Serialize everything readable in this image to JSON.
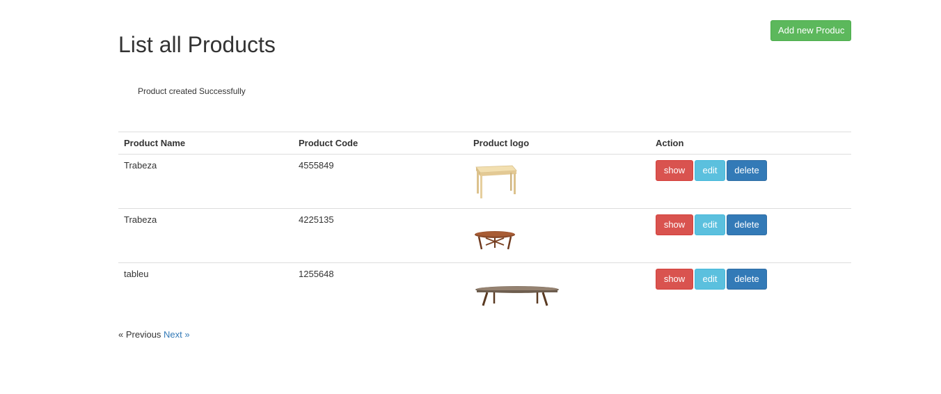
{
  "header": {
    "title": "List all Products",
    "add_button_label": "Add new Produc"
  },
  "alert": {
    "message": "Product created Successfully"
  },
  "table": {
    "columns": [
      "Product Name",
      "Product Code",
      "Product logo",
      "Action"
    ],
    "rows": [
      {
        "name": "Trabeza",
        "code": "4555849",
        "logo_icon": "wooden-table-image"
      },
      {
        "name": "Trabeza",
        "code": "4225135",
        "logo_icon": "round-coffee-table-image"
      },
      {
        "name": "tableu",
        "code": "1255648",
        "logo_icon": "low-bench-table-image"
      }
    ],
    "actions": {
      "show": "show",
      "edit": "edit",
      "delete": "delete"
    }
  },
  "pagination": {
    "previous": "« Previous",
    "next": "Next »"
  },
  "colors": {
    "success": "#5cb85c",
    "danger": "#d9534f",
    "info": "#5bc0de",
    "primary": "#337ab7"
  }
}
